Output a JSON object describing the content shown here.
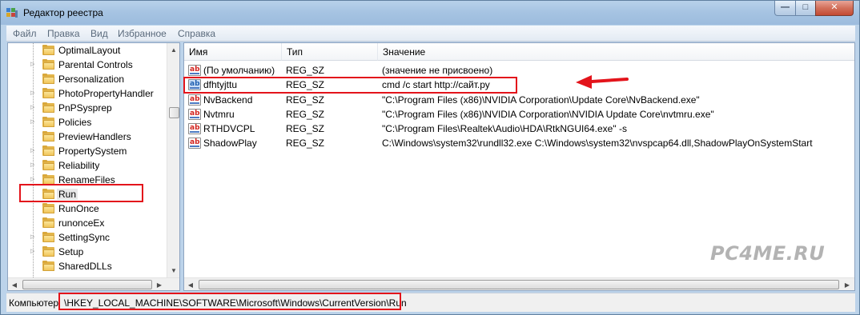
{
  "window": {
    "title": "Редактор реестра"
  },
  "window_buttons": {
    "minimize": "—",
    "maximize": "□",
    "close": "✕"
  },
  "menu": [
    "Файл",
    "Правка",
    "Вид",
    "Избранное",
    "Справка"
  ],
  "tree": {
    "items": [
      {
        "label": "OptimalLayout",
        "expandable": false
      },
      {
        "label": "Parental Controls",
        "expandable": true
      },
      {
        "label": "Personalization",
        "expandable": false
      },
      {
        "label": "PhotoPropertyHandler",
        "expandable": true
      },
      {
        "label": "PnPSysprep",
        "expandable": true
      },
      {
        "label": "Policies",
        "expandable": true
      },
      {
        "label": "PreviewHandlers",
        "expandable": false
      },
      {
        "label": "PropertySystem",
        "expandable": true
      },
      {
        "label": "Reliability",
        "expandable": true
      },
      {
        "label": "RenameFiles",
        "expandable": true
      },
      {
        "label": "Run",
        "expandable": false,
        "selected": true
      },
      {
        "label": "RunOnce",
        "expandable": false
      },
      {
        "label": "runonceEx",
        "expandable": false
      },
      {
        "label": "SettingSync",
        "expandable": true
      },
      {
        "label": "Setup",
        "expandable": true
      },
      {
        "label": "SharedDLLs",
        "expandable": false
      }
    ]
  },
  "list": {
    "columns": {
      "name": "Имя",
      "type": "Тип",
      "value": "Значение"
    },
    "rows": [
      {
        "name": "(По умолчанию)",
        "type": "REG_SZ",
        "value": "(значение не присвоено)"
      },
      {
        "name": "dfhtyjttu",
        "type": "REG_SZ",
        "value": "cmd /c start http://сайт.ру",
        "highlighted": true
      },
      {
        "name": "NvBackend",
        "type": "REG_SZ",
        "value": "\"C:\\Program Files (x86)\\NVIDIA Corporation\\Update Core\\NvBackend.exe\""
      },
      {
        "name": "Nvtmru",
        "type": "REG_SZ",
        "value": "\"C:\\Program Files (x86)\\NVIDIA Corporation\\NVIDIA Update Core\\nvtmru.exe\""
      },
      {
        "name": "RTHDVCPL",
        "type": "REG_SZ",
        "value": "\"C:\\Program Files\\Realtek\\Audio\\HDA\\RtkNGUI64.exe\" -s"
      },
      {
        "name": "ShadowPlay",
        "type": "REG_SZ",
        "value": "C:\\Windows\\system32\\rundll32.exe C:\\Windows\\system32\\nvspcap64.dll,ShadowPlayOnSystemStart"
      }
    ]
  },
  "status": {
    "prefix": "Компьютер",
    "path": "\\HKEY_LOCAL_MACHINE\\SOFTWARE\\Microsoft\\Windows\\CurrentVersion\\Run"
  },
  "watermark": "PC4ME.RU",
  "colors": {
    "annotation": "#e3141b",
    "folder": "#f1c65a",
    "title_bar": "#a5c3e2"
  }
}
